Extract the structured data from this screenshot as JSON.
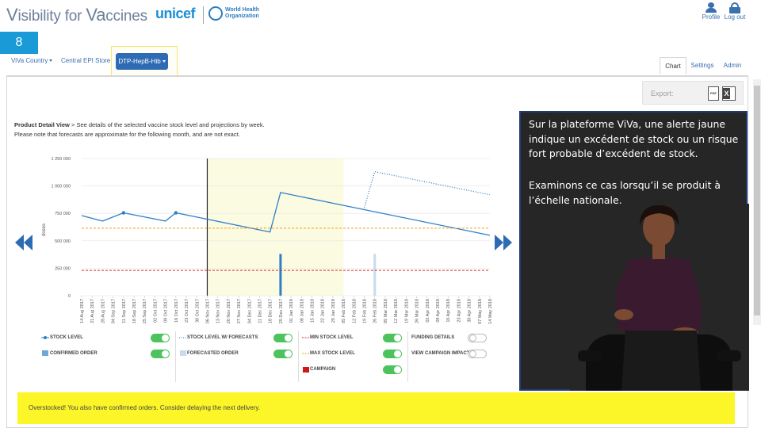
{
  "header": {
    "logo_v": "V",
    "logo_mid": "isibility for ",
    "logo_va": "Va",
    "logo_end": "ccines",
    "partner_unicef": "unicef",
    "partner_who": "World Health\nOrganization",
    "profile_label": "Profile",
    "logout_label": "Log out"
  },
  "step_number": "8",
  "nav": {
    "country": "ViVa Country",
    "store": "Central EPI Store",
    "vaccine": "DTP-HepB-Hib"
  },
  "tabs": [
    {
      "label": "Chart",
      "active": true
    },
    {
      "label": "Settings",
      "active": false
    },
    {
      "label": "Admin",
      "active": false
    }
  ],
  "export": {
    "label": "Export:",
    "pdf": "PDF"
  },
  "product_detail": {
    "title_bold": "Product Detail View",
    "title_rest": " > See details of the selected vaccine stock level and projections by week.",
    "note": "Please note that forecasts are approximate for the following month, and are not exact."
  },
  "chart_data": {
    "type": "line",
    "ylabel": "doses",
    "ylim": [
      0,
      1250000
    ],
    "yticks": [
      "0",
      "250 000",
      "500 000",
      "750 000",
      "1 000 000",
      "1 250 000"
    ],
    "ytick_values": [
      0,
      250000,
      500000,
      750000,
      1000000,
      1250000
    ],
    "x_dates": [
      "14 Aug 2017",
      "21 Aug 2017",
      "28 Aug 2017",
      "04 Sep 2017",
      "11 Sep 2017",
      "18 Sep 2017",
      "25 Sep 2017",
      "02 Oct 2017",
      "09 Oct 2017",
      "16 Oct 2017",
      "23 Oct 2017",
      "30 Oct 2017",
      "06 Nov 2017",
      "13 Nov 2017",
      "20 Nov 2017",
      "27 Nov 2017",
      "04 Dec 2017",
      "11 Dec 2017",
      "18 Dec 2017",
      "25 Dec 2017",
      "01 Jan 2018",
      "08 Jan 2018",
      "15 Jan 2018",
      "22 Jan 2018",
      "29 Jan 2018",
      "05 Feb 2018",
      "12 Feb 2018",
      "19 Feb 2018",
      "26 Feb 2018",
      "05 Mar 2018",
      "12 Mar 2018",
      "19 Mar 2018",
      "26 Mar 2018",
      "02 Apr 2018",
      "09 Apr 2018",
      "16 Apr 2018",
      "23 Apr 2018",
      "30 Apr 2018",
      "07 May 2018",
      "14 May 2018"
    ],
    "current_week": "06 Nov 2017",
    "forecast_window": [
      "06 Nov 2017",
      "05 Feb 2018"
    ],
    "series": [
      {
        "name": "STOCK LEVEL",
        "color": "#2f7fc8",
        "style": "solid",
        "points": [
          [
            "14 Aug 2017",
            730000
          ],
          [
            "28 Aug 2017",
            680000
          ],
          [
            "11 Sep 2017",
            755000
          ],
          [
            "09 Oct 2017",
            680000
          ],
          [
            "16 Oct 2017",
            755000
          ],
          [
            "18 Dec 2017",
            580000
          ],
          [
            "25 Dec 2017",
            940000
          ],
          [
            "14 May 2018",
            550000
          ]
        ],
        "markers": [
          "11 Sep 2017",
          "16 Oct 2017"
        ]
      },
      {
        "name": "STOCK LEVEL W/ FORECASTS",
        "color": "#2f7fc8",
        "style": "dotted",
        "points": [
          [
            "19 Feb 2018",
            800000
          ],
          [
            "26 Feb 2018",
            1130000
          ],
          [
            "14 May 2018",
            920000
          ]
        ]
      },
      {
        "name": "MIN STOCK LEVEL",
        "color": "#d83030",
        "style": "dashed",
        "value": 230000
      },
      {
        "name": "MAX STOCK LEVEL",
        "color": "#f0a020",
        "style": "dashed",
        "value": 615000
      }
    ],
    "bars": [
      {
        "name": "CONFIRMED ORDER",
        "color": "#2f7fc8",
        "date": "25 Dec 2017",
        "value": 380000
      },
      {
        "name": "FORECASTED ORDER",
        "color": "#c7dbee",
        "date": "26 Feb 2018",
        "value": 380000
      }
    ]
  },
  "legend": {
    "stock_level": "STOCK LEVEL",
    "confirmed_order": "CONFIRMED ORDER",
    "stock_forecasts": "STOCK LEVEL W/ FORECASTS",
    "forecasted_order": "FORECASTED ORDER",
    "min_stock": "MIN STOCK LEVEL",
    "max_stock": "MAX STOCK LEVEL",
    "campaign": "CAMPAIGN",
    "funding": "FUNDING DETAILS",
    "campaign_impact": "VIEW CAMPAIGN IMPACT"
  },
  "alert": {
    "text": "Overstocked! You also have confirmed orders. Consider delaying the next delivery."
  },
  "overlay": {
    "paragraph1": "Sur la plateforme ViVa, une alerte jaune indique un excédent de stock ou un risque fort probable d’excédent de stock.",
    "paragraph2": "Examinons ce cas lorsqu’il se produit à l’échelle nationale."
  },
  "colors": {
    "accent": "#2d6bb4",
    "alert": "#fcf629",
    "toggle_on": "#4cc35d"
  }
}
